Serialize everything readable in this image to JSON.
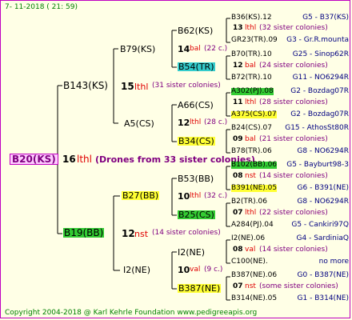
{
  "header": {
    "date": "7-  11-2018  (  21:  59)"
  },
  "footer": {
    "copyright": "Copyright 2004-2018 @ Karl Kehrle Foundation   www.pedigreeapis.org"
  },
  "root": {
    "label": "B20(KS)",
    "num": "16",
    "pop": "lthl",
    "drones": "(Drones from 33 sister colonies)"
  },
  "gen1": {
    "top": {
      "label": "B143(KS)",
      "num": "15",
      "pop": "lthl",
      "sis": "(31 sister colonies)"
    },
    "bottom": {
      "label": "B19(BB)",
      "num": "12",
      "pop": "nst",
      "sis": "(14 sister colonies)"
    }
  },
  "gen2": {
    "a": {
      "label": "B79(KS)",
      "num": "14",
      "pop": "bal",
      "sis": "(22 c.)"
    },
    "b": {
      "label": "A5(CS)",
      "num": "12",
      "pop": "lthl",
      "sis": "(28 c.)"
    },
    "c": {
      "label": "B27(BB)",
      "num": "10",
      "pop": "lthl",
      "sis": "(32 c.)"
    },
    "d": {
      "label": "I2(NE)",
      "num": "10",
      "pop": "val",
      "sis": "(9 c.)"
    }
  },
  "gen3": {
    "a1": {
      "label": "B62(KS)"
    },
    "a2": {
      "label": "B54(TR)"
    },
    "b1": {
      "label": "A66(CS)"
    },
    "b2": {
      "label": "B34(CS)"
    },
    "c1": {
      "label": "B53(BB)"
    },
    "c2": {
      "label": "B25(CS)"
    },
    "d1": {
      "label": "I2(NE)"
    },
    "d2": {
      "label": "B387(NE)"
    }
  },
  "gen4": [
    {
      "label": "B36(KS).12",
      "right": "G5 - B37(KS)"
    },
    {
      "num": "13",
      "pop": "lthl",
      "sis": "(32 sister colonies)"
    },
    {
      "label": "GR23(TR).09",
      "right": "G3 - Gr.R.mounta"
    },
    {
      "label": "B70(TR).10",
      "right": "G25 - Sinop62R"
    },
    {
      "num": "12",
      "pop": "bal",
      "sis": "(24 sister colonies)"
    },
    {
      "label": "B72(TR).10",
      "right": "G11 - NO6294R"
    },
    {
      "label": "A302(PJ).08",
      "right": "G2 - Bozdag07R"
    },
    {
      "num": "11",
      "pop": "lthl",
      "sis": "(28 sister colonies)"
    },
    {
      "label": "A375(CS).07",
      "right": "G2 - Bozdag07R"
    },
    {
      "label": "B24(CS).07",
      "right": "G15 - AthosSt80R"
    },
    {
      "num": "09",
      "pop": "bal",
      "sis": "(21 sister colonies)"
    },
    {
      "label": "B78(TR).06",
      "right": "G8 - NO6294R"
    },
    {
      "label": "B102(BB).06",
      "right": "G5 - Bayburt98-3"
    },
    {
      "num": "08",
      "pop": "nst",
      "sis": "(14 sister colonies)"
    },
    {
      "label": "B391(NE).05",
      "right": "G6 - B391(NE)"
    },
    {
      "label": "B2(TR).06",
      "right": "G8 - NO6294R"
    },
    {
      "num": "07",
      "pop": "lthl",
      "sis": "(22 sister colonies)"
    },
    {
      "label": "A284(PJ).04",
      "right": "G5 - Cankiri97Q"
    },
    {
      "label": "I2(NE).06",
      "right": "G4 - SardiniaQ"
    },
    {
      "num": "08",
      "pop": "val",
      "sis": "(14 sister colonies)"
    },
    {
      "label": "C100(NE).",
      "right": "no more"
    },
    {
      "label": "B387(NE).06",
      "right": "G0 - B387(NE)"
    },
    {
      "num": "07",
      "pop": "nst",
      "sis": "(some sister colonies)"
    },
    {
      "label": "B314(NE).05",
      "right": "G1 - B314(NE)"
    }
  ]
}
